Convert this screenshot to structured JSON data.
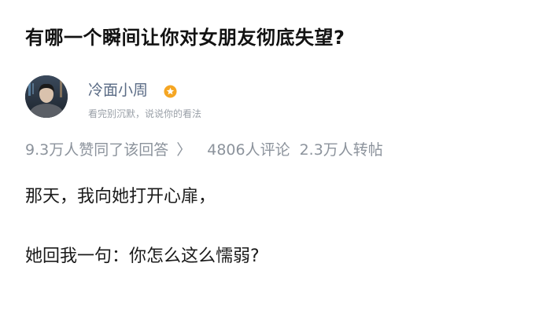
{
  "question": {
    "title": "有哪一个瞬间让你对女朋友彻底失望?"
  },
  "author": {
    "name": "冷面小周",
    "bio": "看完别沉默，说说你的看法",
    "badge_icon": "star-badge-icon",
    "badge_color": "#f5a623"
  },
  "stats": {
    "likes": "9.3万人赞同了该回答",
    "chevron": "〉",
    "comments": "4806人评论",
    "reposts": "2.3万人转帖"
  },
  "answer": {
    "paragraphs": [
      "那天，我向她打开心扉，",
      "她回我一句：你怎么这么懦弱?"
    ]
  }
}
